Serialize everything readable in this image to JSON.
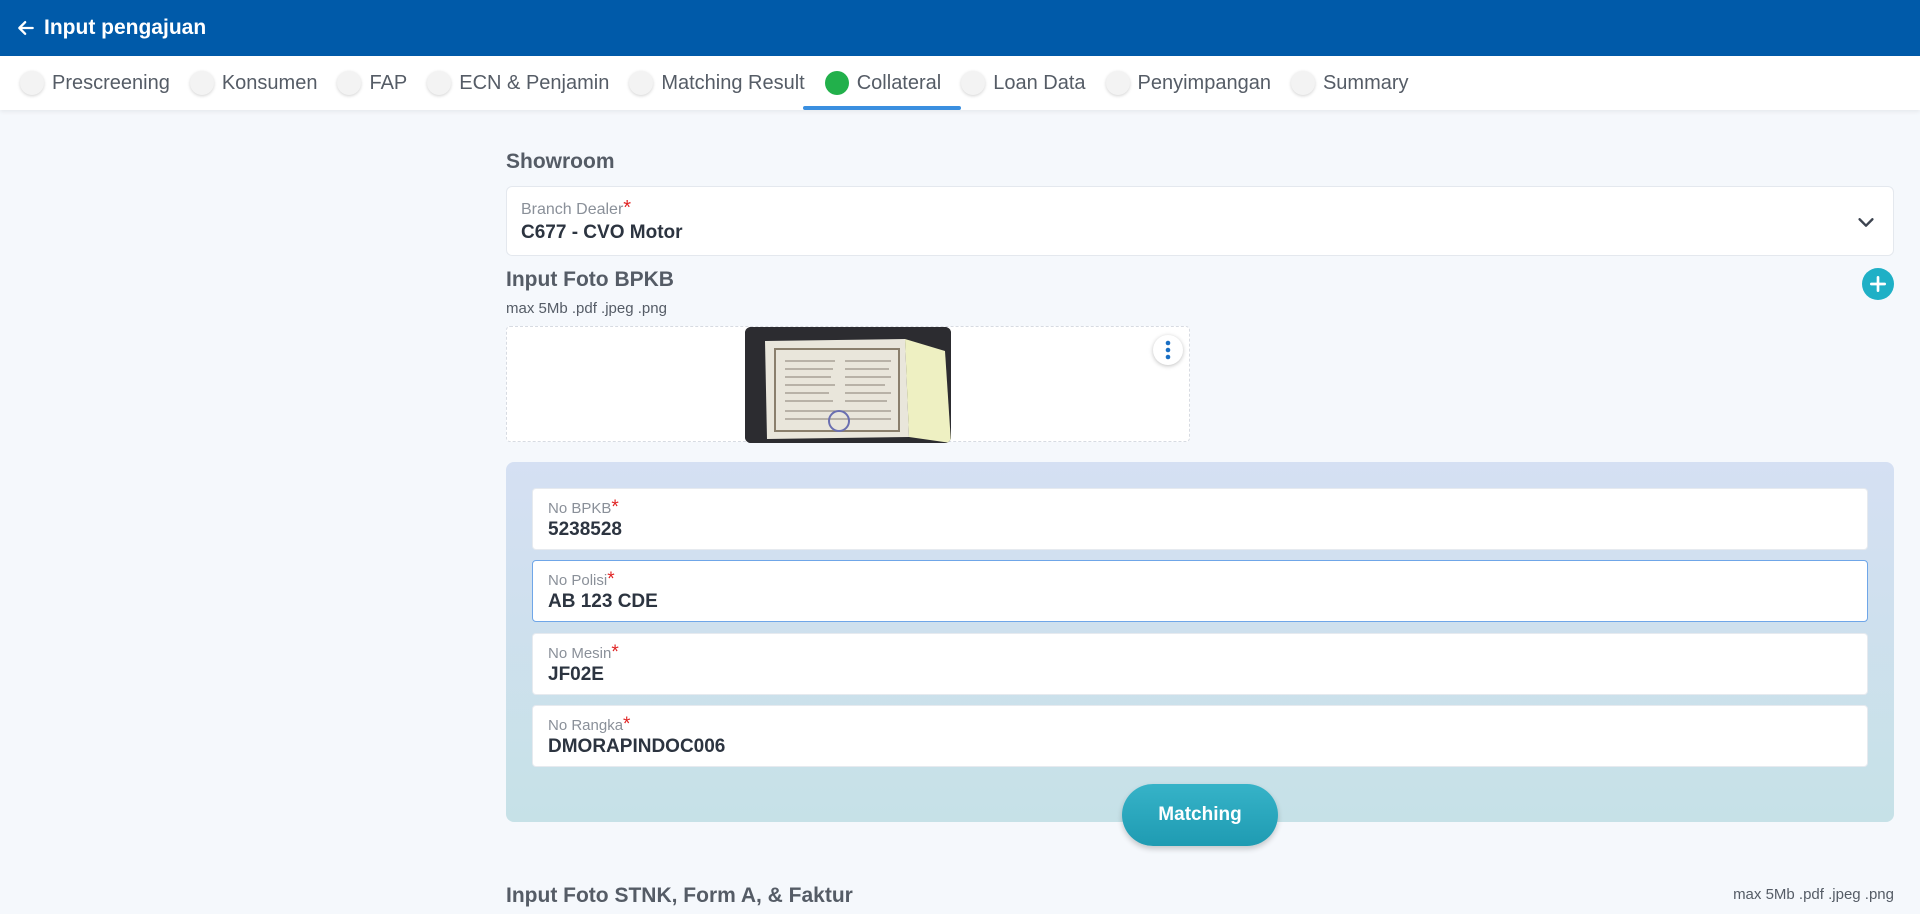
{
  "header": {
    "title": "Input pengajuan"
  },
  "tabs": [
    {
      "label": "Prescreening"
    },
    {
      "label": "Konsumen"
    },
    {
      "label": "FAP"
    },
    {
      "label": "ECN & Penjamin"
    },
    {
      "label": "Matching Result"
    },
    {
      "label": "Collateral"
    },
    {
      "label": "Loan Data"
    },
    {
      "label": "Penyimpangan"
    },
    {
      "label": "Summary"
    }
  ],
  "active_tab": "Collateral",
  "showroom": {
    "title": "Showroom",
    "branch_label": "Branch Dealer",
    "branch_value": "C677 - CVO Motor"
  },
  "bpkb_upload": {
    "title": "Input Foto BPKB",
    "hint": "max 5Mb .pdf .jpeg .png"
  },
  "fields": {
    "no_bpkb": {
      "label": "No BPKB",
      "value": "5238528"
    },
    "no_polisi": {
      "label": "No Polisi",
      "value": "AB 123 CDE"
    },
    "no_mesin": {
      "label": "No Mesin",
      "value": "JF02E"
    },
    "no_rangka": {
      "label": "No Rangka",
      "value": "DMORAPINDOC006"
    }
  },
  "required_mark": "*",
  "matching_button": "Matching",
  "stnk_upload": {
    "title": "Input Foto STNK, Form A, & Faktur",
    "hint": "max 5Mb .pdf .jpeg .png"
  },
  "colors": {
    "header_bg": "#005aa9",
    "active_dot": "#22b04b",
    "active_underline": "#3a8fe0",
    "accent": "#1fb0c6",
    "required": "#e02424"
  }
}
